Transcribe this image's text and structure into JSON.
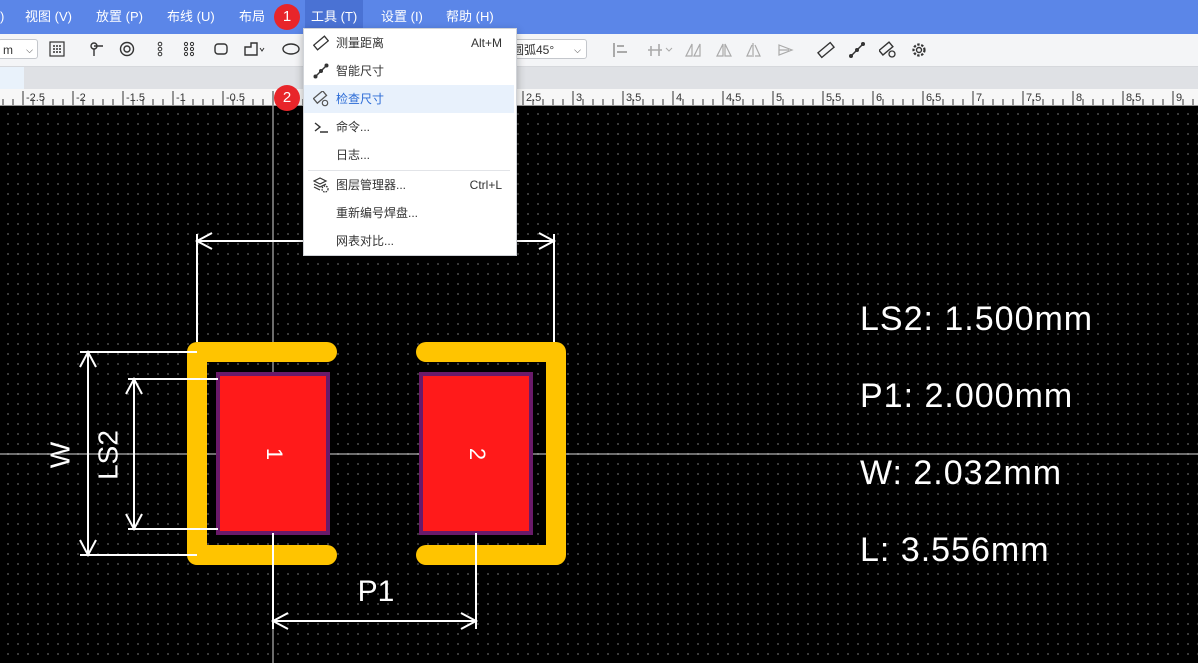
{
  "menubar": {
    "items": [
      {
        "label": ")"
      },
      {
        "label": "视图 (V)"
      },
      {
        "label": "放置 (P)"
      },
      {
        "label": "布线 (U)"
      },
      {
        "label": "布局"
      },
      {
        "label": "工具 (T)"
      },
      {
        "label": "设置 (I)"
      },
      {
        "label": "帮助 (H)"
      }
    ]
  },
  "toolbar": {
    "unit_value": "m",
    "arc_select_value": "圆弧45°"
  },
  "ruler": {
    "labels": [
      "-2.5",
      "-2",
      "-1.5",
      "-1",
      "-0.5",
      "2.5",
      "3",
      "3.5",
      "4",
      "4.5",
      "5",
      "5.5",
      "6",
      "6.5",
      "7",
      "7.5",
      "8",
      "8.5",
      "9"
    ]
  },
  "tools_menu": {
    "items": [
      {
        "label": "测量距离",
        "shortcut": "Alt+M",
        "icon": "ruler-icon"
      },
      {
        "label": "智能尺寸",
        "shortcut": "",
        "icon": "smart-dimension-icon"
      },
      {
        "label": "检查尺寸",
        "shortcut": "",
        "icon": "check-dimension-icon"
      },
      {
        "label": "命令...",
        "shortcut": "",
        "icon": "command-prompt-icon"
      },
      {
        "label": "日志...",
        "shortcut": "",
        "icon": ""
      },
      {
        "label": "图层管理器...",
        "shortcut": "Ctrl+L",
        "icon": "layer-manager-icon"
      },
      {
        "label": "重新编号焊盘...",
        "shortcut": "",
        "icon": ""
      },
      {
        "label": "网表对比...",
        "shortcut": "",
        "icon": ""
      }
    ]
  },
  "badges": {
    "one": "1",
    "two": "2"
  },
  "pcb": {
    "pad1": "1",
    "pad2": "2",
    "dim_w": "W",
    "dim_ls2": "LS2",
    "dim_p1": "P1"
  },
  "measurements": {
    "ls2": "LS2: 1.500mm",
    "p1": "P1: 2.000mm",
    "w": "W: 2.032mm",
    "l": "L: 3.556mm"
  },
  "colors": {
    "menubar": "#5b86e8",
    "silkscreen": "#ffc400",
    "pad": "#ff1a1a",
    "pad_outline": "#6a1a6a",
    "badge": "#e8252a",
    "menu_highlight": "#e8f1fc"
  }
}
